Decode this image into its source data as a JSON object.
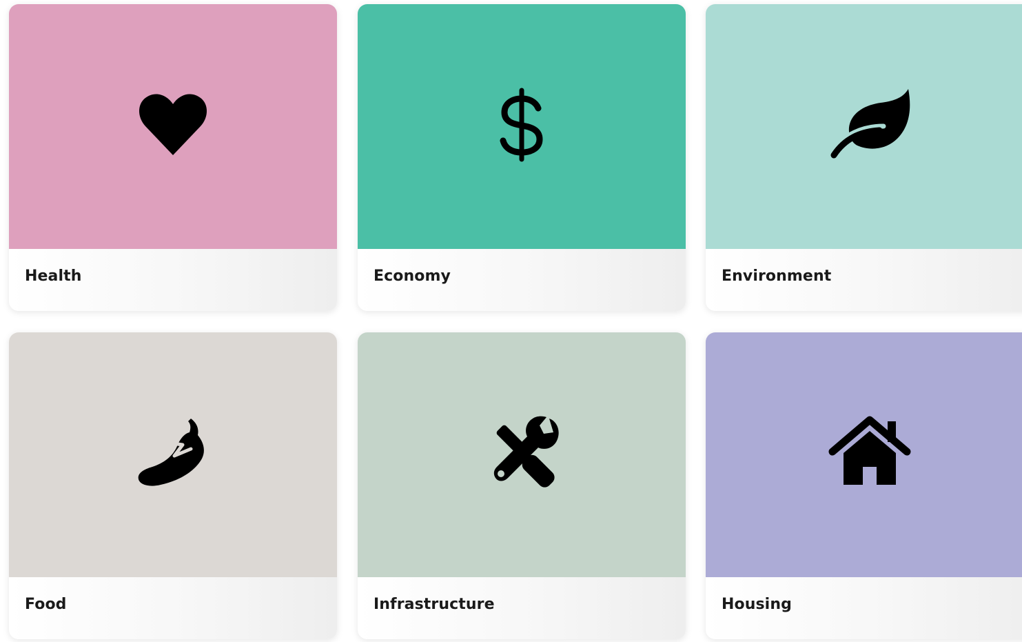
{
  "categories": [
    {
      "label": "Health",
      "icon": "heart-icon",
      "color": "#dea0bd"
    },
    {
      "label": "Economy",
      "icon": "dollar-icon",
      "color": "#4bbfa6"
    },
    {
      "label": "Environment",
      "icon": "leaf-icon",
      "color": "#abdbd4"
    },
    {
      "label": "Food",
      "icon": "chili-pepper-icon",
      "color": "#dcd8d4"
    },
    {
      "label": "Infrastructure",
      "icon": "tools-icon",
      "color": "#c4d4c9"
    },
    {
      "label": "Housing",
      "icon": "house-icon",
      "color": "#acabd6"
    }
  ]
}
